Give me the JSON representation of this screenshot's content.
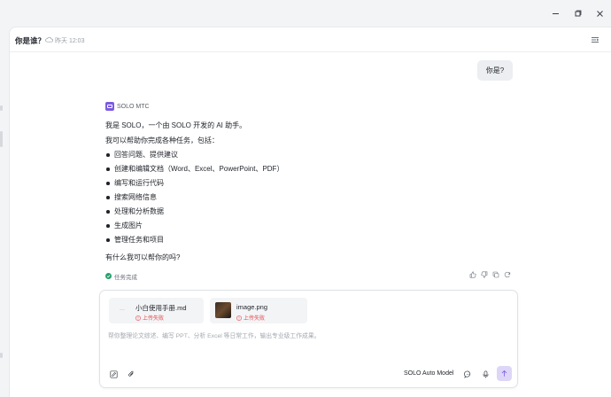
{
  "conversation": {
    "title": "你是谁？",
    "time": "昨天 12:03"
  },
  "messages": {
    "user_text": "你是?",
    "assistant_name": "SOLO MTC",
    "intro": "我是 SOLO，一个由 SOLO 开发的 AI 助手。",
    "subtitle": "我可以帮助你完成各种任务，包括：",
    "capabilities": [
      "回答问题、提供建议",
      "创建和编辑文档（Word、Excel、PowerPoint、PDF）",
      "编写和运行代码",
      "搜索网络信息",
      "处理和分析数据",
      "生成图片",
      "管理任务和项目"
    ],
    "closing": "有什么我可以帮你的吗?",
    "task_status": "任务完成"
  },
  "composer": {
    "attachments": [
      {
        "name": "小白使用手册.md",
        "thumb": "···",
        "status": "上传失败"
      },
      {
        "name": "image.png",
        "status": "上传失败"
      }
    ],
    "placeholder": "帮你整理论文综述、编写 PPT、分析 Excel 等日常工作，输出专业级工作成果。",
    "model": "SOLO Auto Model"
  },
  "icons": {
    "window": [
      "minimize-icon",
      "maximize-icon",
      "close-icon"
    ],
    "header": [
      "cloud-icon",
      "menu-icon"
    ],
    "actions": [
      "thumbs-up-icon",
      "thumbs-down-icon",
      "copy-icon",
      "refresh-icon"
    ],
    "composer": [
      "edit-icon",
      "paperclip-icon",
      "chat-icon",
      "microphone-icon",
      "arrow-up-icon"
    ]
  },
  "colors": {
    "accent": "#7c5ce0",
    "send_button": "#ddd6f6",
    "success": "#22a06b",
    "error": "#e5484d"
  }
}
